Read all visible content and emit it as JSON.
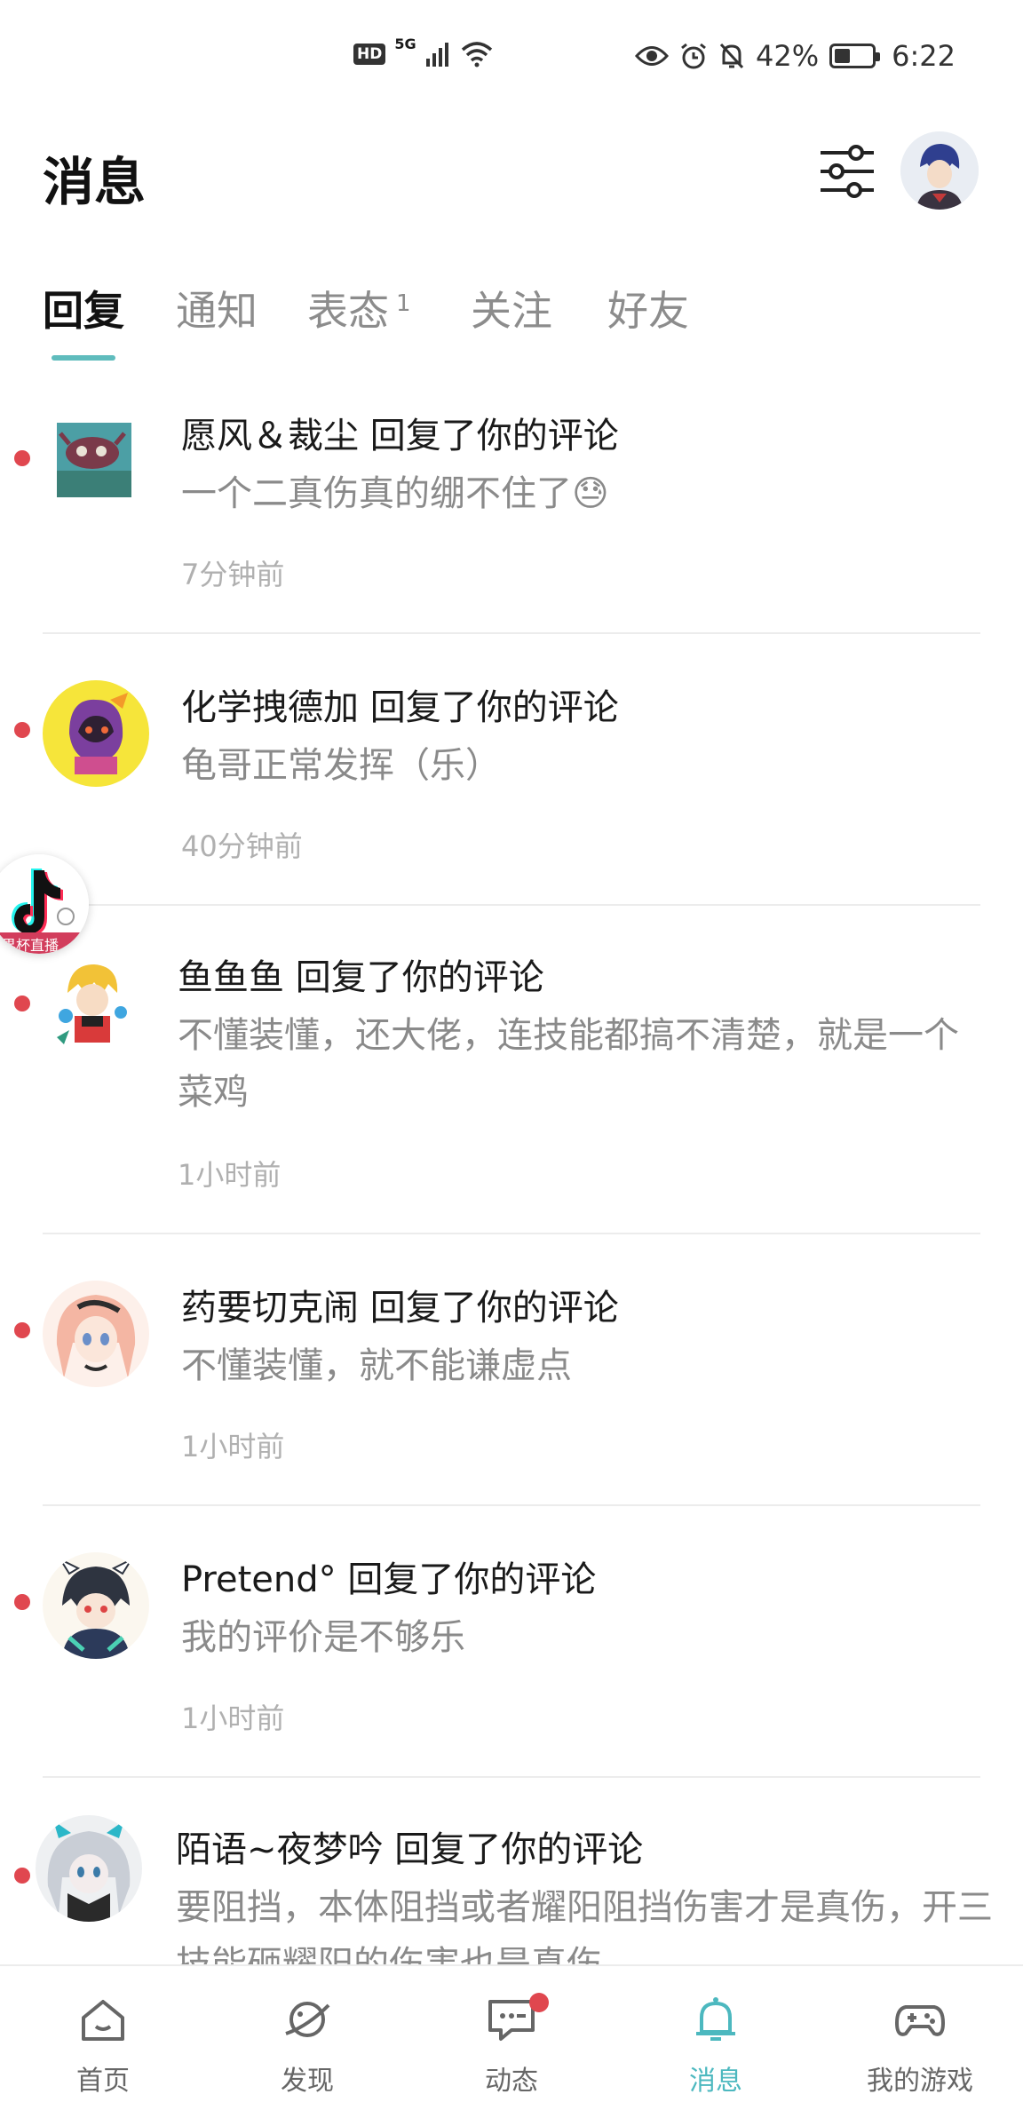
{
  "status_bar": {
    "hd": "HD",
    "network": "5G",
    "battery": "42%",
    "battery_level": 0.42,
    "time": "6:22"
  },
  "header": {
    "title": "消息"
  },
  "tabs": [
    {
      "label": "回复",
      "active": true,
      "badge": ""
    },
    {
      "label": "通知",
      "active": false,
      "badge": ""
    },
    {
      "label": "表态",
      "active": false,
      "badge": "1"
    },
    {
      "label": "关注",
      "active": false,
      "badge": ""
    },
    {
      "label": "好友",
      "active": false,
      "badge": ""
    }
  ],
  "messages": [
    {
      "title": "愿风＆裁尘 回复了你的评论",
      "body": "一个二真伤真的绷不住了😓",
      "time": "7分钟前",
      "unread": true
    },
    {
      "title": "化学拽德加 回复了你的评论",
      "body": "龟哥正常发挥（乐）",
      "time": "40分钟前",
      "unread": true
    },
    {
      "title": "鱼鱼鱼 回复了你的评论",
      "body": "不懂装懂，还大佬，连技能都搞不清楚，就是一个菜鸡",
      "time": "1小时前",
      "unread": true
    },
    {
      "title": "药要切克闹 回复了你的评论",
      "body": "不懂装懂，就不能谦虚点",
      "time": "1小时前",
      "unread": true
    },
    {
      "title": "Pretend° 回复了你的评论",
      "body": "我的评价是不够乐",
      "time": "1小时前",
      "unread": true
    },
    {
      "title": "陌语~夜梦吟 回复了你的评论",
      "body": "要阻挡，本体阻挡或者耀阳阻挡伤害才是真伤，开三技能砸耀阳的伤害也是真伤",
      "time": "",
      "unread": true
    }
  ],
  "floating_widget": {
    "label": "界杯直播"
  },
  "bottom_nav": [
    {
      "label": "首页",
      "icon": "home-icon",
      "active": false
    },
    {
      "label": "发现",
      "icon": "planet-icon",
      "active": false
    },
    {
      "label": "动态",
      "icon": "chat-icon",
      "active": false,
      "dot": true
    },
    {
      "label": "消息",
      "icon": "bell-icon",
      "active": true
    },
    {
      "label": "我的游戏",
      "icon": "gamepad-icon",
      "active": false
    }
  ],
  "colors": {
    "accent": "#4cb8bf",
    "unread": "#e0474f",
    "secondary_text": "#8a8a8a"
  }
}
